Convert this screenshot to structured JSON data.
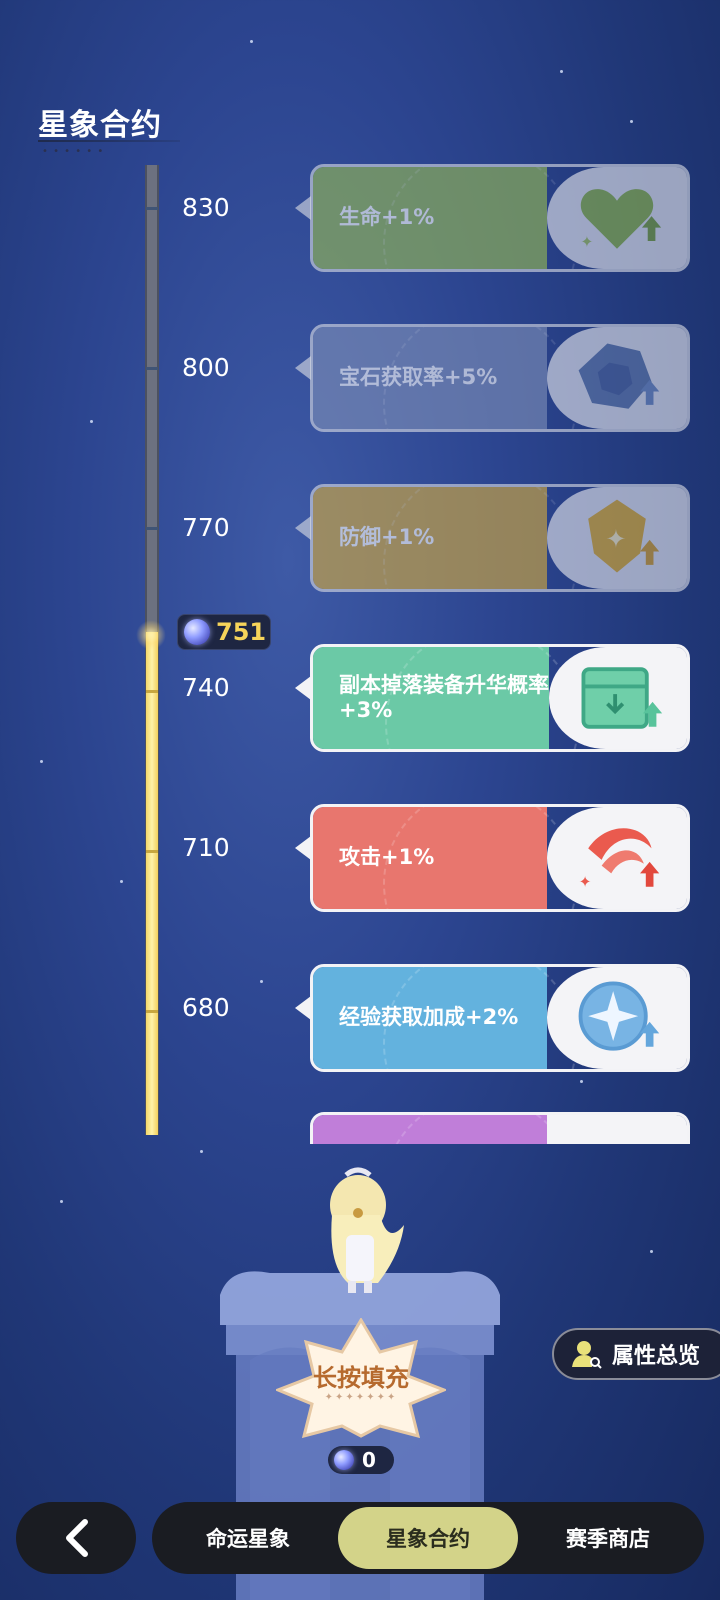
{
  "page": {
    "title": "星象合约"
  },
  "progress": {
    "current_value": "751",
    "max_visible": 830
  },
  "levels": [
    {
      "label": "830",
      "reward": "生命+1%",
      "icon": "heart-up-icon",
      "color": "#97bb54",
      "unlocked": false
    },
    {
      "label": "800",
      "reward": "宝石获取率+5%",
      "icon": "gem-up-icon",
      "color": "#7e8fb8",
      "unlocked": false
    },
    {
      "label": "770",
      "reward": "防御+1%",
      "icon": "shield-up-icon",
      "color": "#d6ac3e",
      "unlocked": false
    },
    {
      "label": "740",
      "reward": "副本掉落装备升华概率+3%",
      "icon": "box-up-icon",
      "color": "#6bc9a6",
      "unlocked": true
    },
    {
      "label": "710",
      "reward": "攻击+1%",
      "icon": "slash-up-icon",
      "color": "#e8766e",
      "unlocked": true
    },
    {
      "label": "680",
      "reward": "经验获取加成+2%",
      "icon": "exp-star-up-icon",
      "color": "#63b2de",
      "unlocked": true
    }
  ],
  "fill_button": {
    "label": "长按填充",
    "cost": "0"
  },
  "overview_button": {
    "label": "属性总览"
  },
  "nav": {
    "back_icon": "chevron-left-icon",
    "tabs": [
      {
        "label": "命运星象",
        "active": false
      },
      {
        "label": "星象合约",
        "active": true
      },
      {
        "label": "赛季商店",
        "active": false
      }
    ]
  }
}
